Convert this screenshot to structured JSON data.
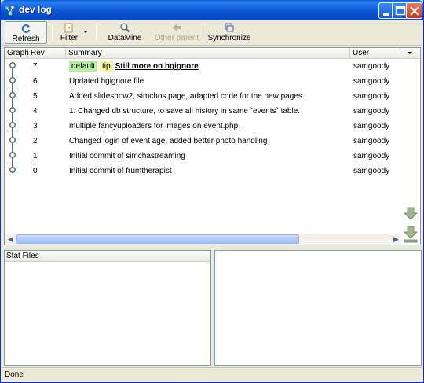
{
  "window": {
    "title": "dev log"
  },
  "toolbar": {
    "refresh": "Refresh",
    "filter": "Filter",
    "datamine": "DataMine",
    "other_parent": "Other parent",
    "synchronize": "Synchronize"
  },
  "columns": {
    "graph": "Graph",
    "rev": "Rev",
    "summary": "Summary",
    "user": "User"
  },
  "revisions": [
    {
      "rev": "7",
      "tags": [
        "default",
        "tip"
      ],
      "summary": "Still more on hgignore",
      "user": "samgoody"
    },
    {
      "rev": "6",
      "tags": [],
      "summary": "Updated hgignore file",
      "user": "samgoody"
    },
    {
      "rev": "5",
      "tags": [],
      "summary": "Added slideshow2, simchos page, adapted code for the new pages.",
      "user": "samgoody"
    },
    {
      "rev": "4",
      "tags": [],
      "summary": "1. Changed db structure, to save all history in same `events` table.",
      "user": "samgoody"
    },
    {
      "rev": "3",
      "tags": [],
      "summary": "multiple fancyuploaders for images on event.php,",
      "user": "samgoody"
    },
    {
      "rev": "2",
      "tags": [],
      "summary": "Changed login of event age, added better photo handling",
      "user": "samgoody"
    },
    {
      "rev": "1",
      "tags": [],
      "summary": "Initial commit of simchastreaming",
      "user": "samgoody"
    },
    {
      "rev": "0",
      "tags": [],
      "summary": "Initial commit of frumtherapist",
      "user": "samgoody"
    }
  ],
  "stat_files": {
    "header": "Stat Files"
  },
  "status": {
    "text": "Done"
  },
  "colors": {
    "title_bar": "#0b57d0",
    "tag_default": "#b2f0a0",
    "tag_tip": "#f6f39b",
    "border": "#7f9db9"
  }
}
